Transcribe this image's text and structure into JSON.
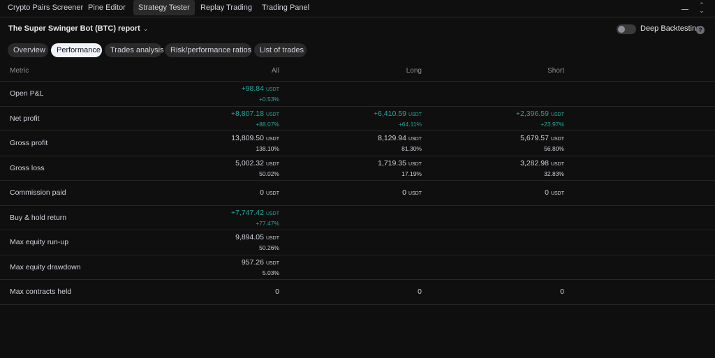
{
  "nav": {
    "tabs": [
      "Crypto Pairs Screener",
      "Pine Editor",
      "Strategy Tester",
      "Replay Trading",
      "Trading Panel"
    ],
    "active": "Strategy Tester"
  },
  "report": {
    "title": "The Super Swinger Bot (BTC) report",
    "deep_backtesting_label": "Deep Backtesting",
    "deep_backtesting_on": false
  },
  "subtabs": [
    "Overview",
    "Performance",
    "Trades analysis",
    "Risk/performance ratios",
    "List of trades"
  ],
  "active_subtab": "Performance",
  "table": {
    "headers": {
      "metric": "Metric",
      "all": "All",
      "long": "Long",
      "short": "Short"
    },
    "unit": "USDT",
    "colors": {
      "positive": "#26a69a"
    },
    "rows": [
      {
        "metric": "Open P&L",
        "all": {
          "v": "+98.84",
          "u": "USDT",
          "p": "+0.53%",
          "pos": true
        },
        "long": null,
        "short": null
      },
      {
        "metric": "Net profit",
        "all": {
          "v": "+8,807.18",
          "u": "USDT",
          "p": "+88.07%",
          "pos": true
        },
        "long": {
          "v": "+6,410.59",
          "u": "USDT",
          "p": "+64.11%",
          "pos": true
        },
        "short": {
          "v": "+2,396.59",
          "u": "USDT",
          "p": "+23.97%",
          "pos": true
        }
      },
      {
        "metric": "Gross profit",
        "all": {
          "v": "13,809.50",
          "u": "USDT",
          "p": "138.10%"
        },
        "long": {
          "v": "8,129.94",
          "u": "USDT",
          "p": "81.30%"
        },
        "short": {
          "v": "5,679.57",
          "u": "USDT",
          "p": "56.80%"
        }
      },
      {
        "metric": "Gross loss",
        "all": {
          "v": "5,002.32",
          "u": "USDT",
          "p": "50.02%"
        },
        "long": {
          "v": "1,719.35",
          "u": "USDT",
          "p": "17.19%"
        },
        "short": {
          "v": "3,282.98",
          "u": "USDT",
          "p": "32.83%"
        }
      },
      {
        "metric": "Commission paid",
        "all": {
          "v": "0",
          "u": "USDT"
        },
        "long": {
          "v": "0",
          "u": "USDT"
        },
        "short": {
          "v": "0",
          "u": "USDT"
        }
      },
      {
        "metric": "Buy & hold return",
        "all": {
          "v": "+7,747.42",
          "u": "USDT",
          "p": "+77.47%",
          "pos": true
        },
        "long": null,
        "short": null
      },
      {
        "metric": "Max equity run-up",
        "all": {
          "v": "9,894.05",
          "u": "USDT",
          "p": "50.26%"
        },
        "long": null,
        "short": null
      },
      {
        "metric": "Max equity drawdown",
        "all": {
          "v": "957.26",
          "u": "USDT",
          "p": "5.03%"
        },
        "long": null,
        "short": null
      },
      {
        "metric": "Max contracts held",
        "all": {
          "v": "0"
        },
        "long": {
          "v": "0"
        },
        "short": {
          "v": "0"
        }
      }
    ]
  }
}
